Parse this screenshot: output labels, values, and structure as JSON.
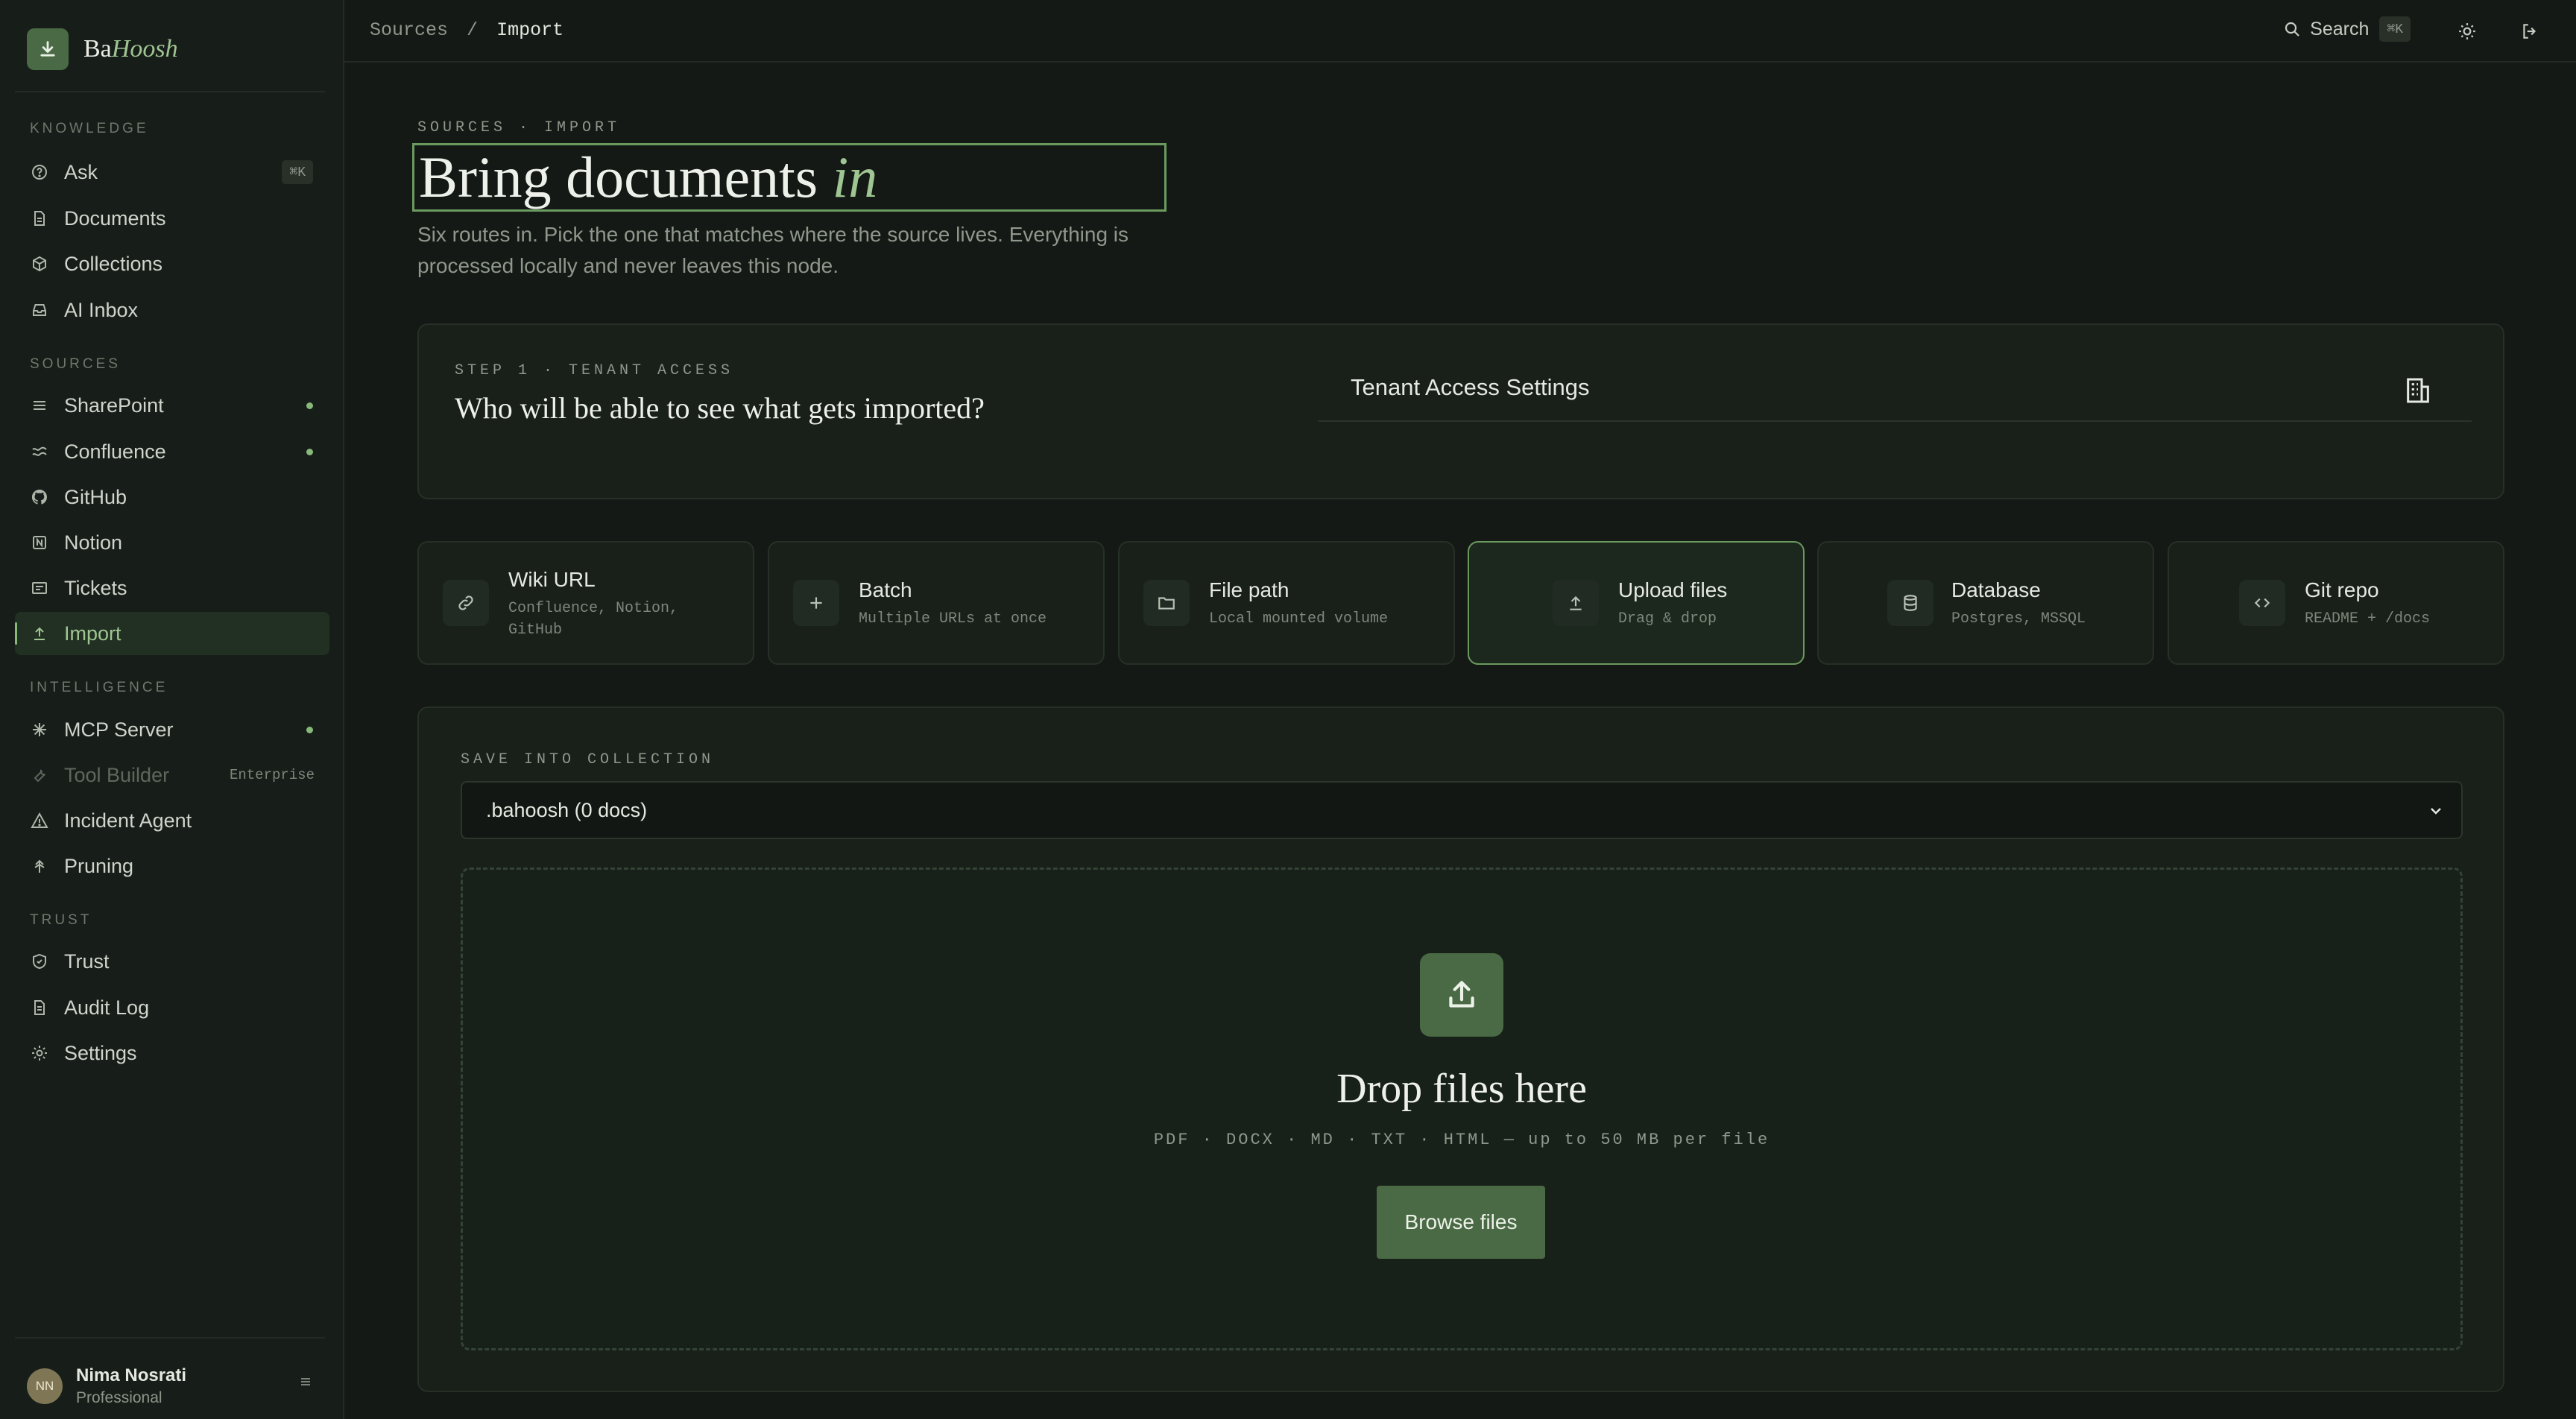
{
  "brand": {
    "name_prefix": "Ba",
    "name_italic": "Hoosh"
  },
  "sidebar": {
    "sections": [
      {
        "label": "KNOWLEDGE"
      },
      {
        "label": "SOURCES"
      },
      {
        "label": "INTELLIGENCE"
      },
      {
        "label": "TRUST"
      }
    ],
    "items": [
      {
        "label": "Ask",
        "icon": "question-circle-icon",
        "kbd": "⌘K"
      },
      {
        "label": "Documents",
        "icon": "document-icon"
      },
      {
        "label": "Collections",
        "icon": "cube-icon"
      },
      {
        "label": "AI Inbox",
        "icon": "inbox-icon"
      },
      {
        "label": "SharePoint",
        "icon": "layers-icon",
        "status": "connected"
      },
      {
        "label": "Confluence",
        "icon": "confluence-icon",
        "status": "connected"
      },
      {
        "label": "GitHub",
        "icon": "github-icon"
      },
      {
        "label": "Notion",
        "icon": "notion-icon"
      },
      {
        "label": "Tickets",
        "icon": "ticket-icon"
      },
      {
        "label": "Import",
        "icon": "upload-icon",
        "active": true
      },
      {
        "label": "MCP Server",
        "icon": "sparkle-icon",
        "status": "connected"
      },
      {
        "label": "Tool Builder",
        "icon": "wrench-icon",
        "tag": "Enterprise",
        "disabled": true
      },
      {
        "label": "Incident Agent",
        "icon": "warning-icon"
      },
      {
        "label": "Pruning",
        "icon": "prune-icon"
      },
      {
        "label": "Trust",
        "icon": "shield-icon"
      },
      {
        "label": "Audit Log",
        "icon": "log-icon"
      },
      {
        "label": "Settings",
        "icon": "gear-icon"
      }
    ]
  },
  "user": {
    "initials": "NN",
    "name": "Nima Nosrati",
    "plan": "Professional"
  },
  "topbar": {
    "breadcrumb_parent": "Sources",
    "breadcrumb_sep": "/",
    "breadcrumb_current": "Import",
    "search_label": "Search",
    "search_kbd": "⌘K"
  },
  "page": {
    "eyebrow": "SOURCES · IMPORT",
    "title_main": "Bring documents",
    "title_italic": "in",
    "subtitle": "Six routes in. Pick the one that matches where the source lives. Everything is processed locally and never leaves this node."
  },
  "tenant": {
    "step": "STEP 1 · TENANT ACCESS",
    "question": "Who will be able to see what gets imported?",
    "settings_label": "Tenant Access Settings"
  },
  "sources": [
    {
      "title": "Wiki URL",
      "desc": "Confluence, Notion, GitHub",
      "icon": "link-icon"
    },
    {
      "title": "Batch",
      "desc": "Multiple URLs at once",
      "icon": "plus-icon"
    },
    {
      "title": "File path",
      "desc": "Local mounted volume",
      "icon": "folder-icon"
    },
    {
      "title": "Upload files",
      "desc": "Drag & drop",
      "icon": "upload-icon",
      "selected": true
    },
    {
      "title": "Database",
      "desc": "Postgres, MSSQL",
      "icon": "database-icon"
    },
    {
      "title": "Git repo",
      "desc": "README + /docs",
      "icon": "code-icon"
    }
  ],
  "upload": {
    "save_label": "SAVE INTO COLLECTION",
    "collection_value": ".bahoosh (0 docs)",
    "drop_title": "Drop files here",
    "formats": "PDF · DOCX · MD · TXT · HTML — up to 50 MB per file",
    "browse_label": "Browse files"
  },
  "colors": {
    "accent": "#86b97a",
    "accent_bg": "#4a6a45",
    "background": "#141915",
    "sidebar": "#171d18"
  }
}
